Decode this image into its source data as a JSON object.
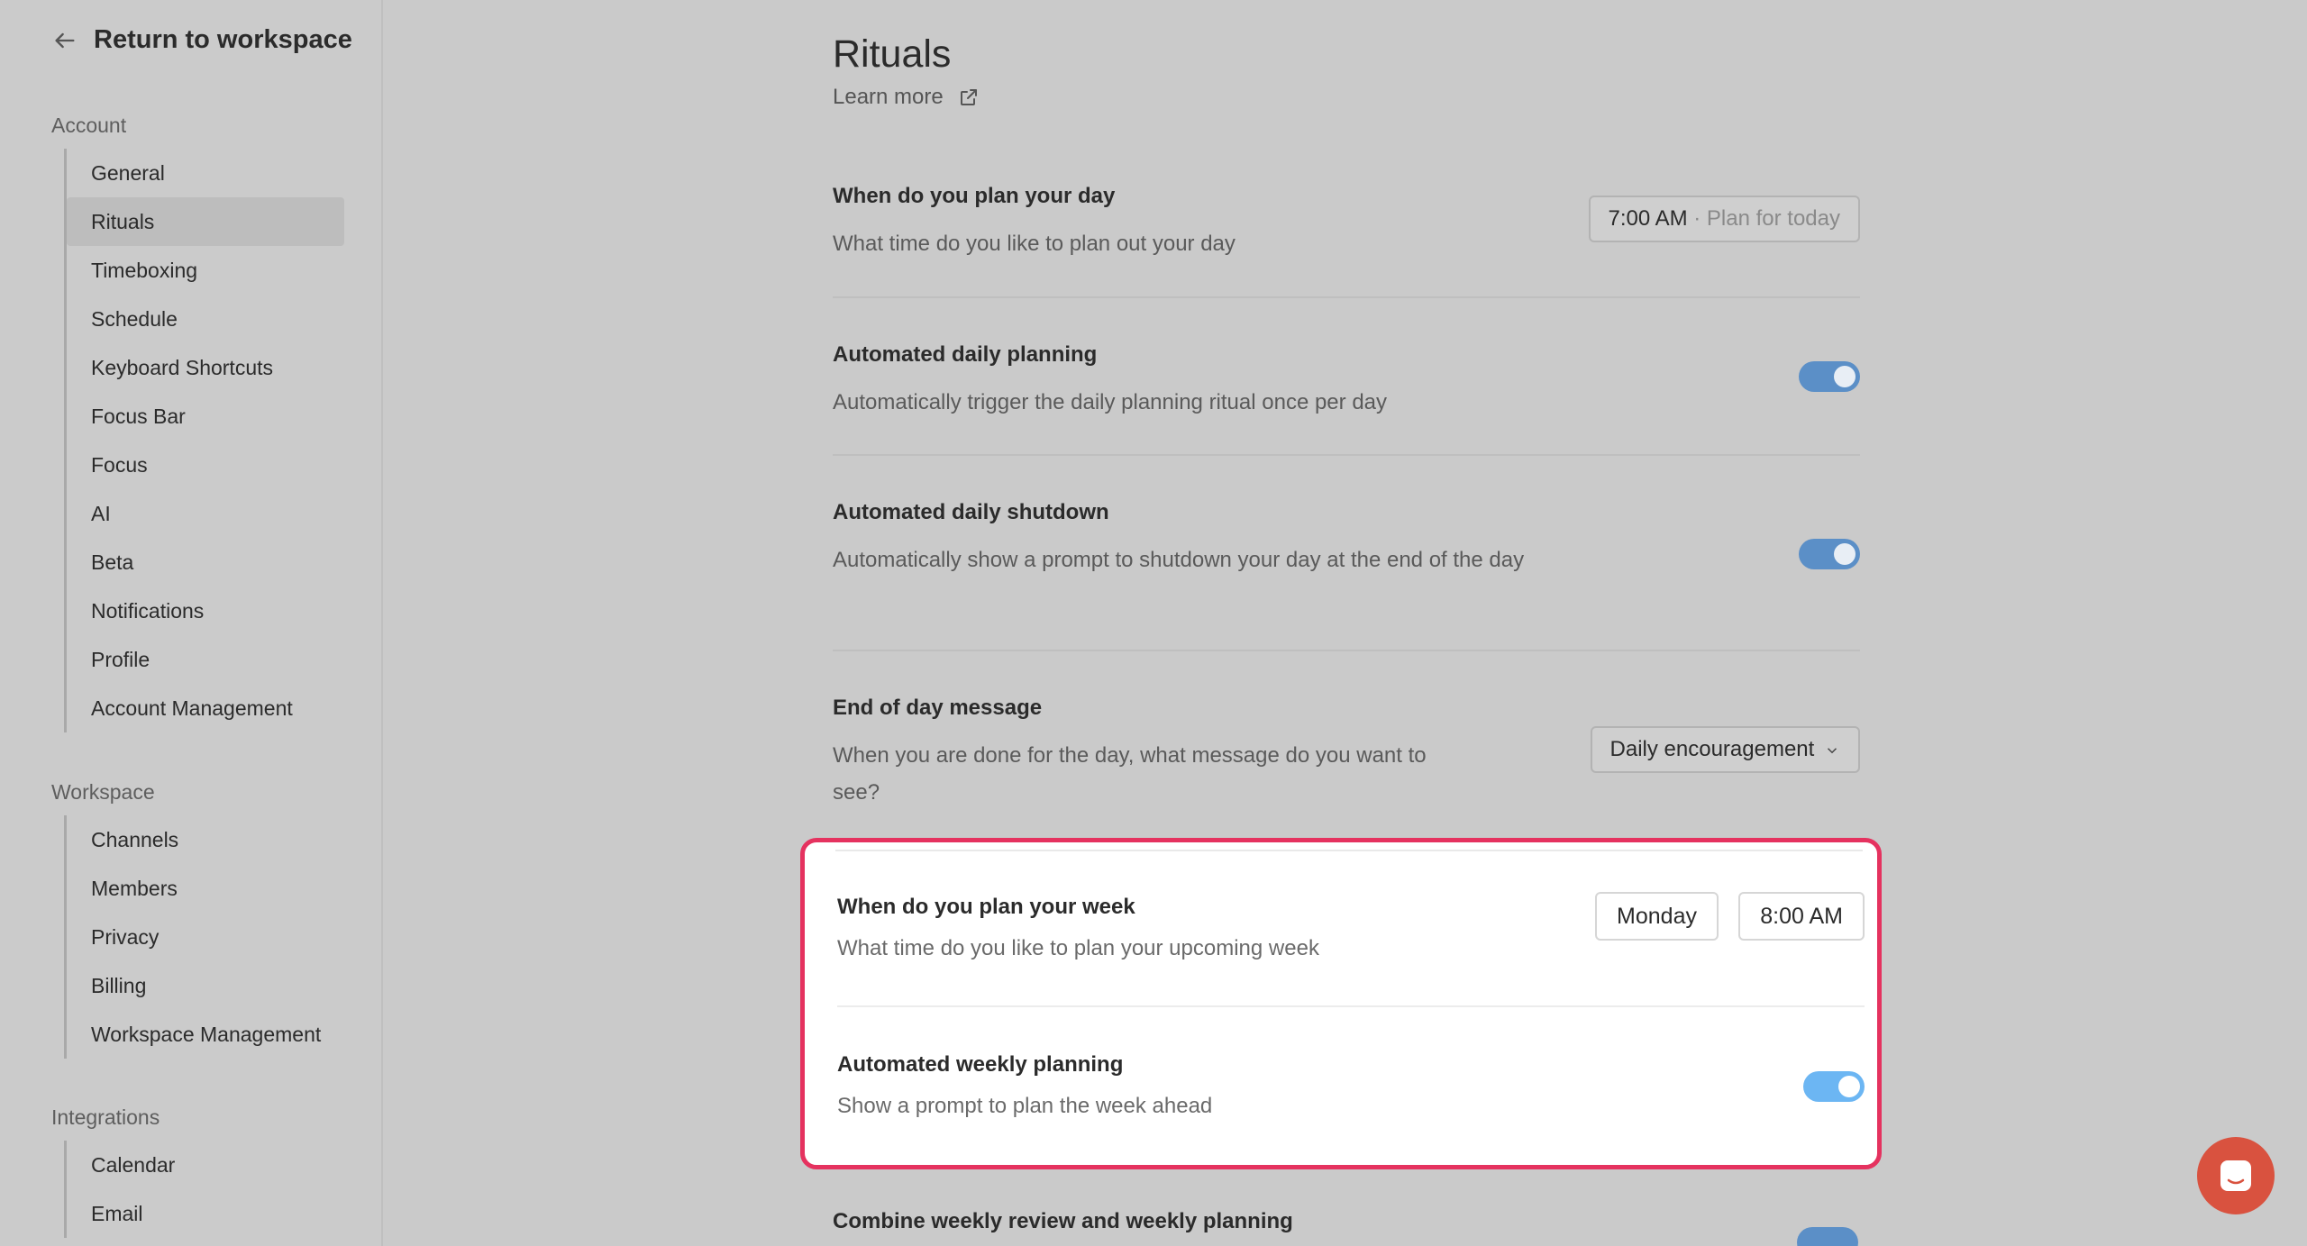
{
  "sidebar": {
    "back_label": "Return to workspace",
    "sections": [
      {
        "title": "Account",
        "items": [
          {
            "label": "General"
          },
          {
            "label": "Rituals",
            "active": true
          },
          {
            "label": "Timeboxing"
          },
          {
            "label": "Schedule"
          },
          {
            "label": "Keyboard Shortcuts"
          },
          {
            "label": "Focus Bar"
          },
          {
            "label": "Focus"
          },
          {
            "label": "AI"
          },
          {
            "label": "Beta"
          },
          {
            "label": "Notifications"
          },
          {
            "label": "Profile"
          },
          {
            "label": "Account Management"
          }
        ]
      },
      {
        "title": "Workspace",
        "items": [
          {
            "label": "Channels"
          },
          {
            "label": "Members"
          },
          {
            "label": "Privacy"
          },
          {
            "label": "Billing"
          },
          {
            "label": "Workspace Management"
          }
        ]
      },
      {
        "title": "Integrations",
        "items": [
          {
            "label": "Calendar"
          },
          {
            "label": "Email"
          }
        ]
      }
    ]
  },
  "main": {
    "title": "Rituals",
    "learn_more": "Learn more",
    "settings": {
      "plan_day": {
        "title": "When do you plan your day",
        "desc": "What time do you like to plan out your day",
        "time": "7:00 AM",
        "suffix": " · Plan for today"
      },
      "auto_daily_planning": {
        "title": "Automated daily planning",
        "desc": "Automatically trigger the daily planning ritual once per day",
        "enabled": true
      },
      "auto_daily_shutdown": {
        "title": "Automated daily shutdown",
        "desc": "Automatically show a prompt to shutdown your day at the end of the day",
        "enabled": true
      },
      "end_of_day_message": {
        "title": "End of day message",
        "desc": "When you are done for the day, what message do you want to see?",
        "value": "Daily encouragement"
      },
      "plan_week": {
        "title": "When do you plan your week",
        "desc": "What time do you like to plan your upcoming week",
        "day": "Monday",
        "time": "8:00 AM"
      },
      "auto_weekly_planning": {
        "title": "Automated weekly planning",
        "desc": "Show a prompt to plan the week ahead",
        "enabled": true
      },
      "combine_weekly": {
        "title": "Combine weekly review and weekly planning",
        "enabled": true
      }
    }
  },
  "colors": {
    "highlight_border": "#e5325f",
    "toggle_on": "#5b8fc7",
    "chat_button": "#d9523f"
  }
}
